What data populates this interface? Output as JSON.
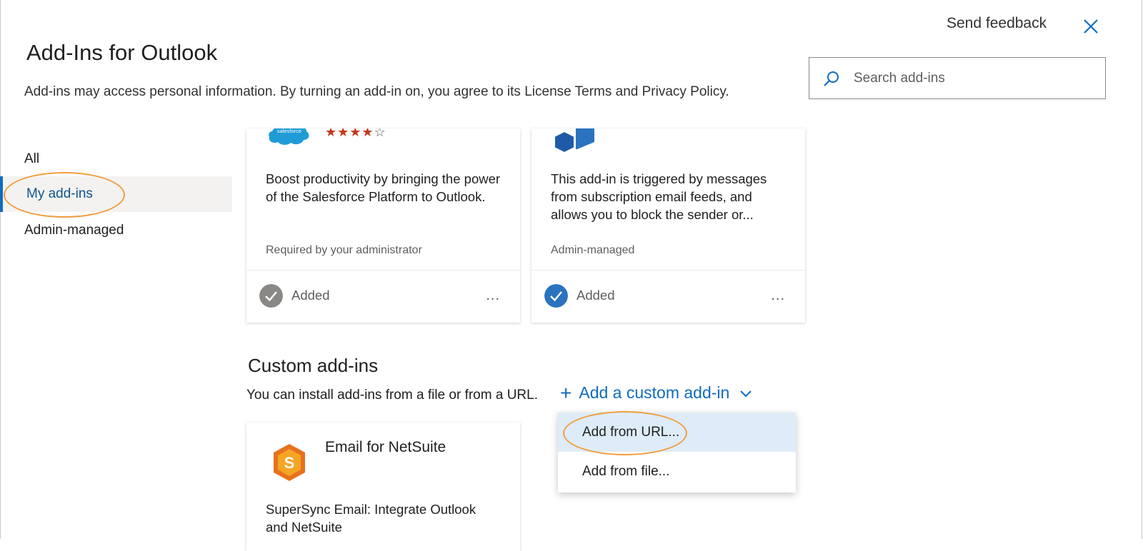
{
  "header": {
    "title": "Add-Ins for Outlook",
    "subtitle": "Add-ins may access personal information. By turning an add-in on, you agree to its License Terms and Privacy Policy.",
    "feedback_label": "Send feedback",
    "close_icon": "close-icon"
  },
  "search": {
    "placeholder": "Search add-ins",
    "value": "",
    "icon": "search-icon"
  },
  "sidebar": {
    "items": [
      {
        "label": "All",
        "selected": false
      },
      {
        "label": "My add-ins",
        "selected": true
      },
      {
        "label": "Admin-managed",
        "selected": false
      }
    ]
  },
  "cards": [
    {
      "logo_text": "salesforce",
      "rating_stars": 4,
      "rating_max": 5,
      "description": "Boost productivity by bringing the power of the Salesforce Platform to Outlook.",
      "meta": "Required by your administrator",
      "status": "Added",
      "more": "..."
    },
    {
      "description": "This add-in is triggered by messages from subscription email feeds, and allows you to block the sender or...",
      "meta": "Admin-managed",
      "status": "Added",
      "more": "..."
    }
  ],
  "custom": {
    "title": "Custom add-ins",
    "note": "You can install add-ins from a file or from a URL.",
    "add_label": "Add a custom add-in",
    "menu": [
      {
        "label": "Add from URL..."
      },
      {
        "label": "Add from file..."
      }
    ]
  },
  "netsuite_card": {
    "title": "Email for NetSuite",
    "description": "SuperSync Email: Integrate Outlook and NetSuite"
  },
  "colors": {
    "accent": "#0f6cbd",
    "highlight_circle": "#f39c3c",
    "menu_hover": "#deecf9"
  }
}
